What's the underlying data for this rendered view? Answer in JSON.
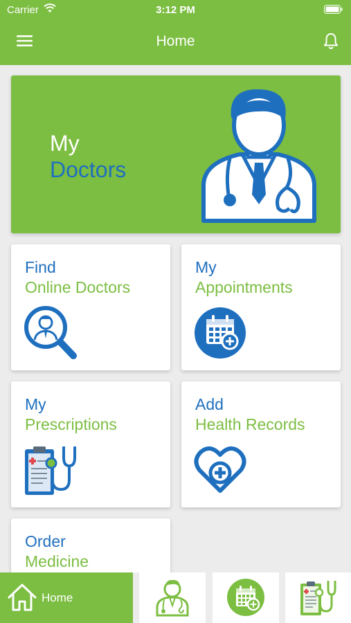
{
  "status_bar": {
    "carrier": "Carrier",
    "time": "3:12 PM"
  },
  "nav": {
    "title": "Home"
  },
  "hero": {
    "line1": "My",
    "line2": "Doctors"
  },
  "tiles": [
    {
      "line1": "Find",
      "line2": "Online Doctors",
      "icon": "doctor-search-icon"
    },
    {
      "line1": "My",
      "line2": "Appointments",
      "icon": "calendar-plus-icon"
    },
    {
      "line1": "My",
      "line2": "Prescriptions",
      "icon": "clipboard-stethoscope-icon"
    },
    {
      "line1": "Add",
      "line2": "Health Records",
      "icon": "heart-plus-icon"
    },
    {
      "line1": "Order",
      "line2": "Medicine",
      "icon": "medicine-icon"
    }
  ],
  "tabbar": {
    "home_label": "Home",
    "tabs": [
      "home-icon",
      "doctor-icon",
      "calendar-plus-icon",
      "clipboard-stethoscope-icon"
    ]
  },
  "colors": {
    "brand_green": "#7cbe42",
    "brand_blue": "#1f6fbf",
    "background": "#ececec"
  }
}
